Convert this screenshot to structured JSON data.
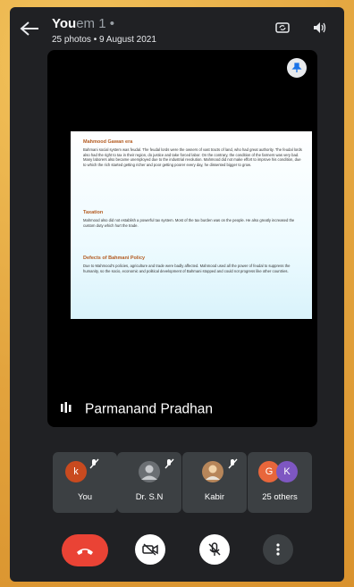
{
  "header": {
    "title": "You",
    "title_ghost": "em 1 •",
    "subtitle": "25 photos  •  9 August 2021"
  },
  "document": {
    "heading1": "Mahmood Gawan era",
    "para1": "Bahmani social system was feudal. The feudal lords were the owners of vast tracts of land, who had great authority. The feudal lords also had the right to tax in their region, do justice and take forced labor. On the contrary, the condition of the farmers was very bad. Many laborers also became unemployed due to the industrial revolution. Mahmood did not make effort to improve his condition, due to which the rich started getting richer and poor getting poorer every day, he dissented bigger to grow.",
    "heading2": "Taxation",
    "para2": "Mahmood also did not establish a powerful tax system. Most of the tax burden was on the people. He also greatly increased the custom duty which hurt the trade.",
    "heading3": "Defects of Bahmani Policy",
    "para3": "Due to Mahmood's policies, agriculture and trade were badly affected. Mahmood used all the power of feudal to suppress the humanity, so the socio, economic and political development of Bahmani stopped and could not progress like other countries."
  },
  "presenter": {
    "name": "Parmanand Pradhan"
  },
  "participants": [
    {
      "avatar": "k",
      "label": "You",
      "color": "#c94a1f"
    },
    {
      "avatar": "",
      "label": "Dr. S.N",
      "color": "#6b6f73"
    },
    {
      "avatar": "",
      "label": "Kabir",
      "color": "#b7865a"
    },
    {
      "avatar": "G",
      "avatar2": "K",
      "label": "25 others",
      "color": "#e8663b",
      "color2": "#7e57c2"
    }
  ],
  "colors": {
    "end_call": "#ea4335",
    "tile_bg": "#3c4043",
    "app_bg": "#202124"
  }
}
